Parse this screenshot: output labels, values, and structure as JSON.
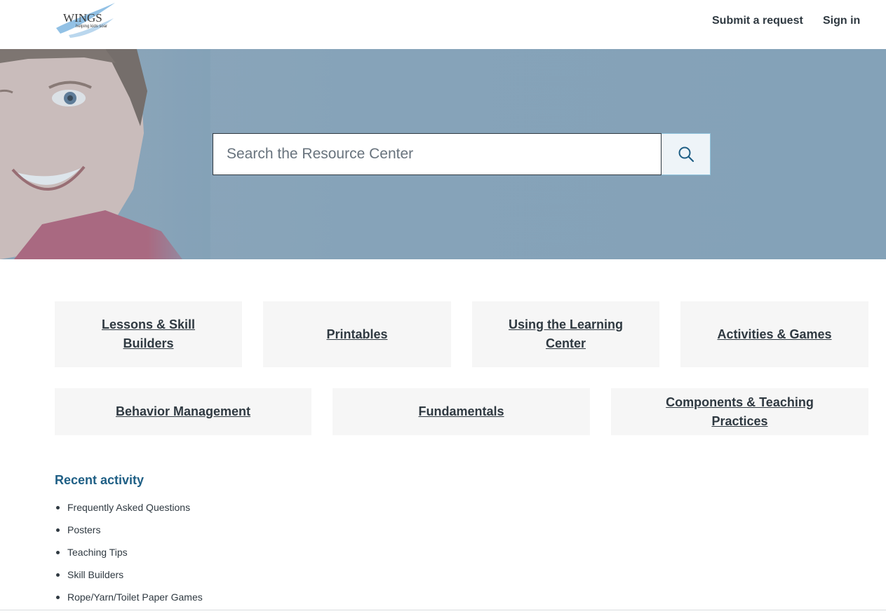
{
  "header": {
    "logo_text": "WINGS",
    "logo_tagline": "helping kids soar",
    "nav": {
      "submit_request": "Submit a request",
      "sign_in": "Sign in"
    }
  },
  "hero": {
    "search": {
      "placeholder": "Search the Resource Center",
      "value": ""
    }
  },
  "categories": {
    "row1": [
      "Lessons & Skill Builders",
      "Printables",
      "Using the Learning Center",
      "Activities & Games"
    ],
    "row2": [
      "Behavior Management",
      "Fundamentals",
      "Components & Teaching Practices"
    ]
  },
  "recent_activity": {
    "title": "Recent activity",
    "items": [
      "Frequently Asked Questions",
      "Posters",
      "Teaching Tips",
      "Skill Builders",
      "Rope/Yarn/Toilet Paper Games"
    ]
  },
  "colors": {
    "hero_overlay": "#84a2b8",
    "accent_link": "#1f5f85",
    "tile_background": "#f6f6f6",
    "search_button_border": "#8fc3dc",
    "logo_swoosh": "#7fb6e0"
  },
  "icons": {
    "search": "search-icon",
    "logo": "wings-logo"
  }
}
